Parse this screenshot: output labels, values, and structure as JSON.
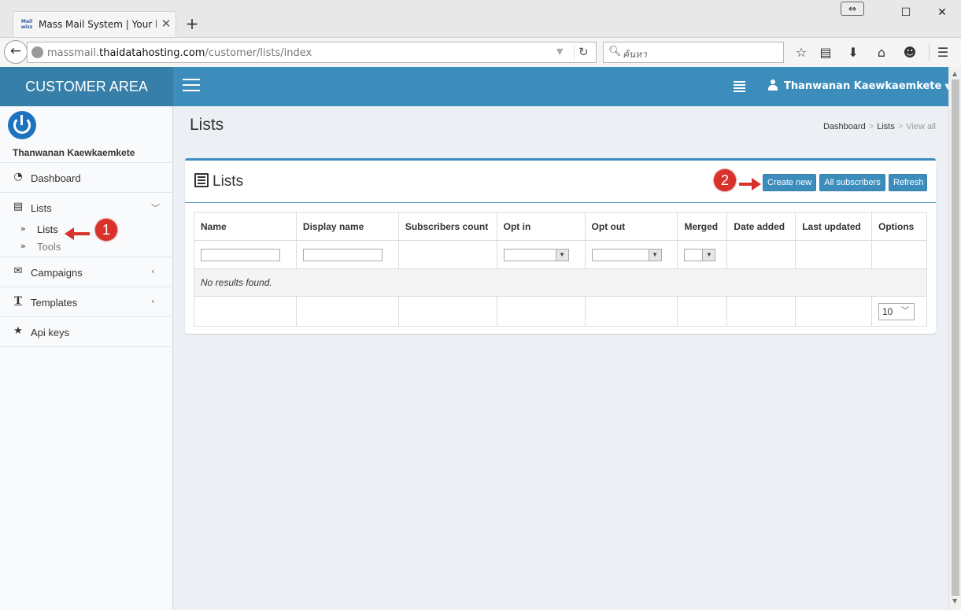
{
  "browser": {
    "tab_favicon": "Mail\nwizz",
    "tab_title": "Mass Mail System | Your li...",
    "new_tab": "+",
    "url_scheme_host_prefix": "massmail.",
    "url_host": "thaidatahosting.com",
    "url_path": "/customer/lists/index",
    "search_placeholder": "ค้นหา"
  },
  "header": {
    "logo_text": "CUSTOMER AREA",
    "user_name": "Thanwanan Kaewkaemkete",
    "accent_color": "#3c8dbc"
  },
  "sidebar": {
    "user_name": "Thanwanan Kaewkaemkete",
    "items": [
      {
        "label": "Dashboard",
        "icon": "dashboard-icon"
      },
      {
        "label": "Lists",
        "icon": "list-icon"
      },
      {
        "label": "Campaigns",
        "icon": "envelope-icon"
      },
      {
        "label": "Templates",
        "icon": "text-icon"
      },
      {
        "label": "Api keys",
        "icon": "star-icon"
      }
    ],
    "subitems": [
      {
        "label": "Lists"
      },
      {
        "label": "Tools"
      }
    ]
  },
  "content": {
    "page_title": "Lists",
    "breadcrumb": [
      "Dashboard",
      "Lists",
      "View all"
    ],
    "box_title": "Lists",
    "buttons": {
      "create_new": "Create new",
      "all_subscribers": "All subscribers",
      "refresh": "Refresh"
    },
    "table": {
      "columns": [
        "Name",
        "Display name",
        "Subscribers count",
        "Opt in",
        "Opt out",
        "Merged",
        "Date added",
        "Last updated",
        "Options"
      ],
      "empty_message": "No results found.",
      "page_size": "10"
    }
  },
  "annotations": {
    "step1": "1",
    "step2": "2"
  }
}
